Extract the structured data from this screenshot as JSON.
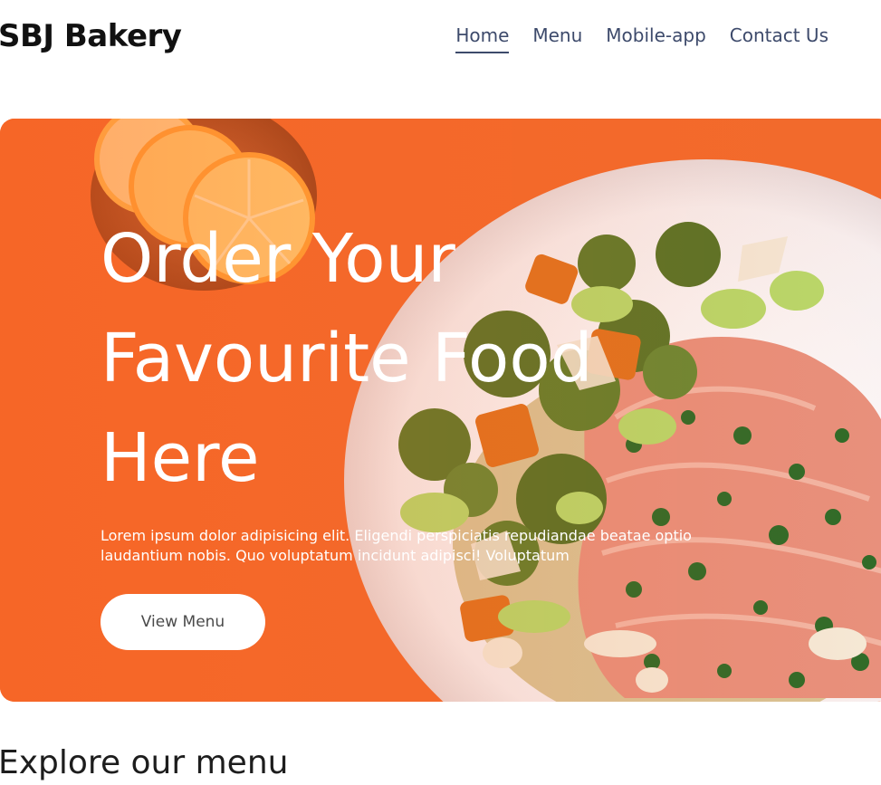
{
  "brand": {
    "name": "SBJ Bakery"
  },
  "nav": {
    "items": [
      {
        "label": "Home",
        "active": true
      },
      {
        "label": "Menu",
        "active": false
      },
      {
        "label": "Mobile-app",
        "active": false
      },
      {
        "label": "Contact Us",
        "active": false
      }
    ]
  },
  "hero": {
    "title": "Order Your\nFavourite Food\nHere",
    "description": "Lorem ipsum dolor adipisicing elit. Eligendi perspiciatis repudiandae beatae optio laudantium nobis. Quo voluptatum incidunt adipisci! Voluptatum",
    "button_label": "View Menu",
    "background_color": "#f2672a"
  },
  "section": {
    "title": "Explore our menu"
  }
}
